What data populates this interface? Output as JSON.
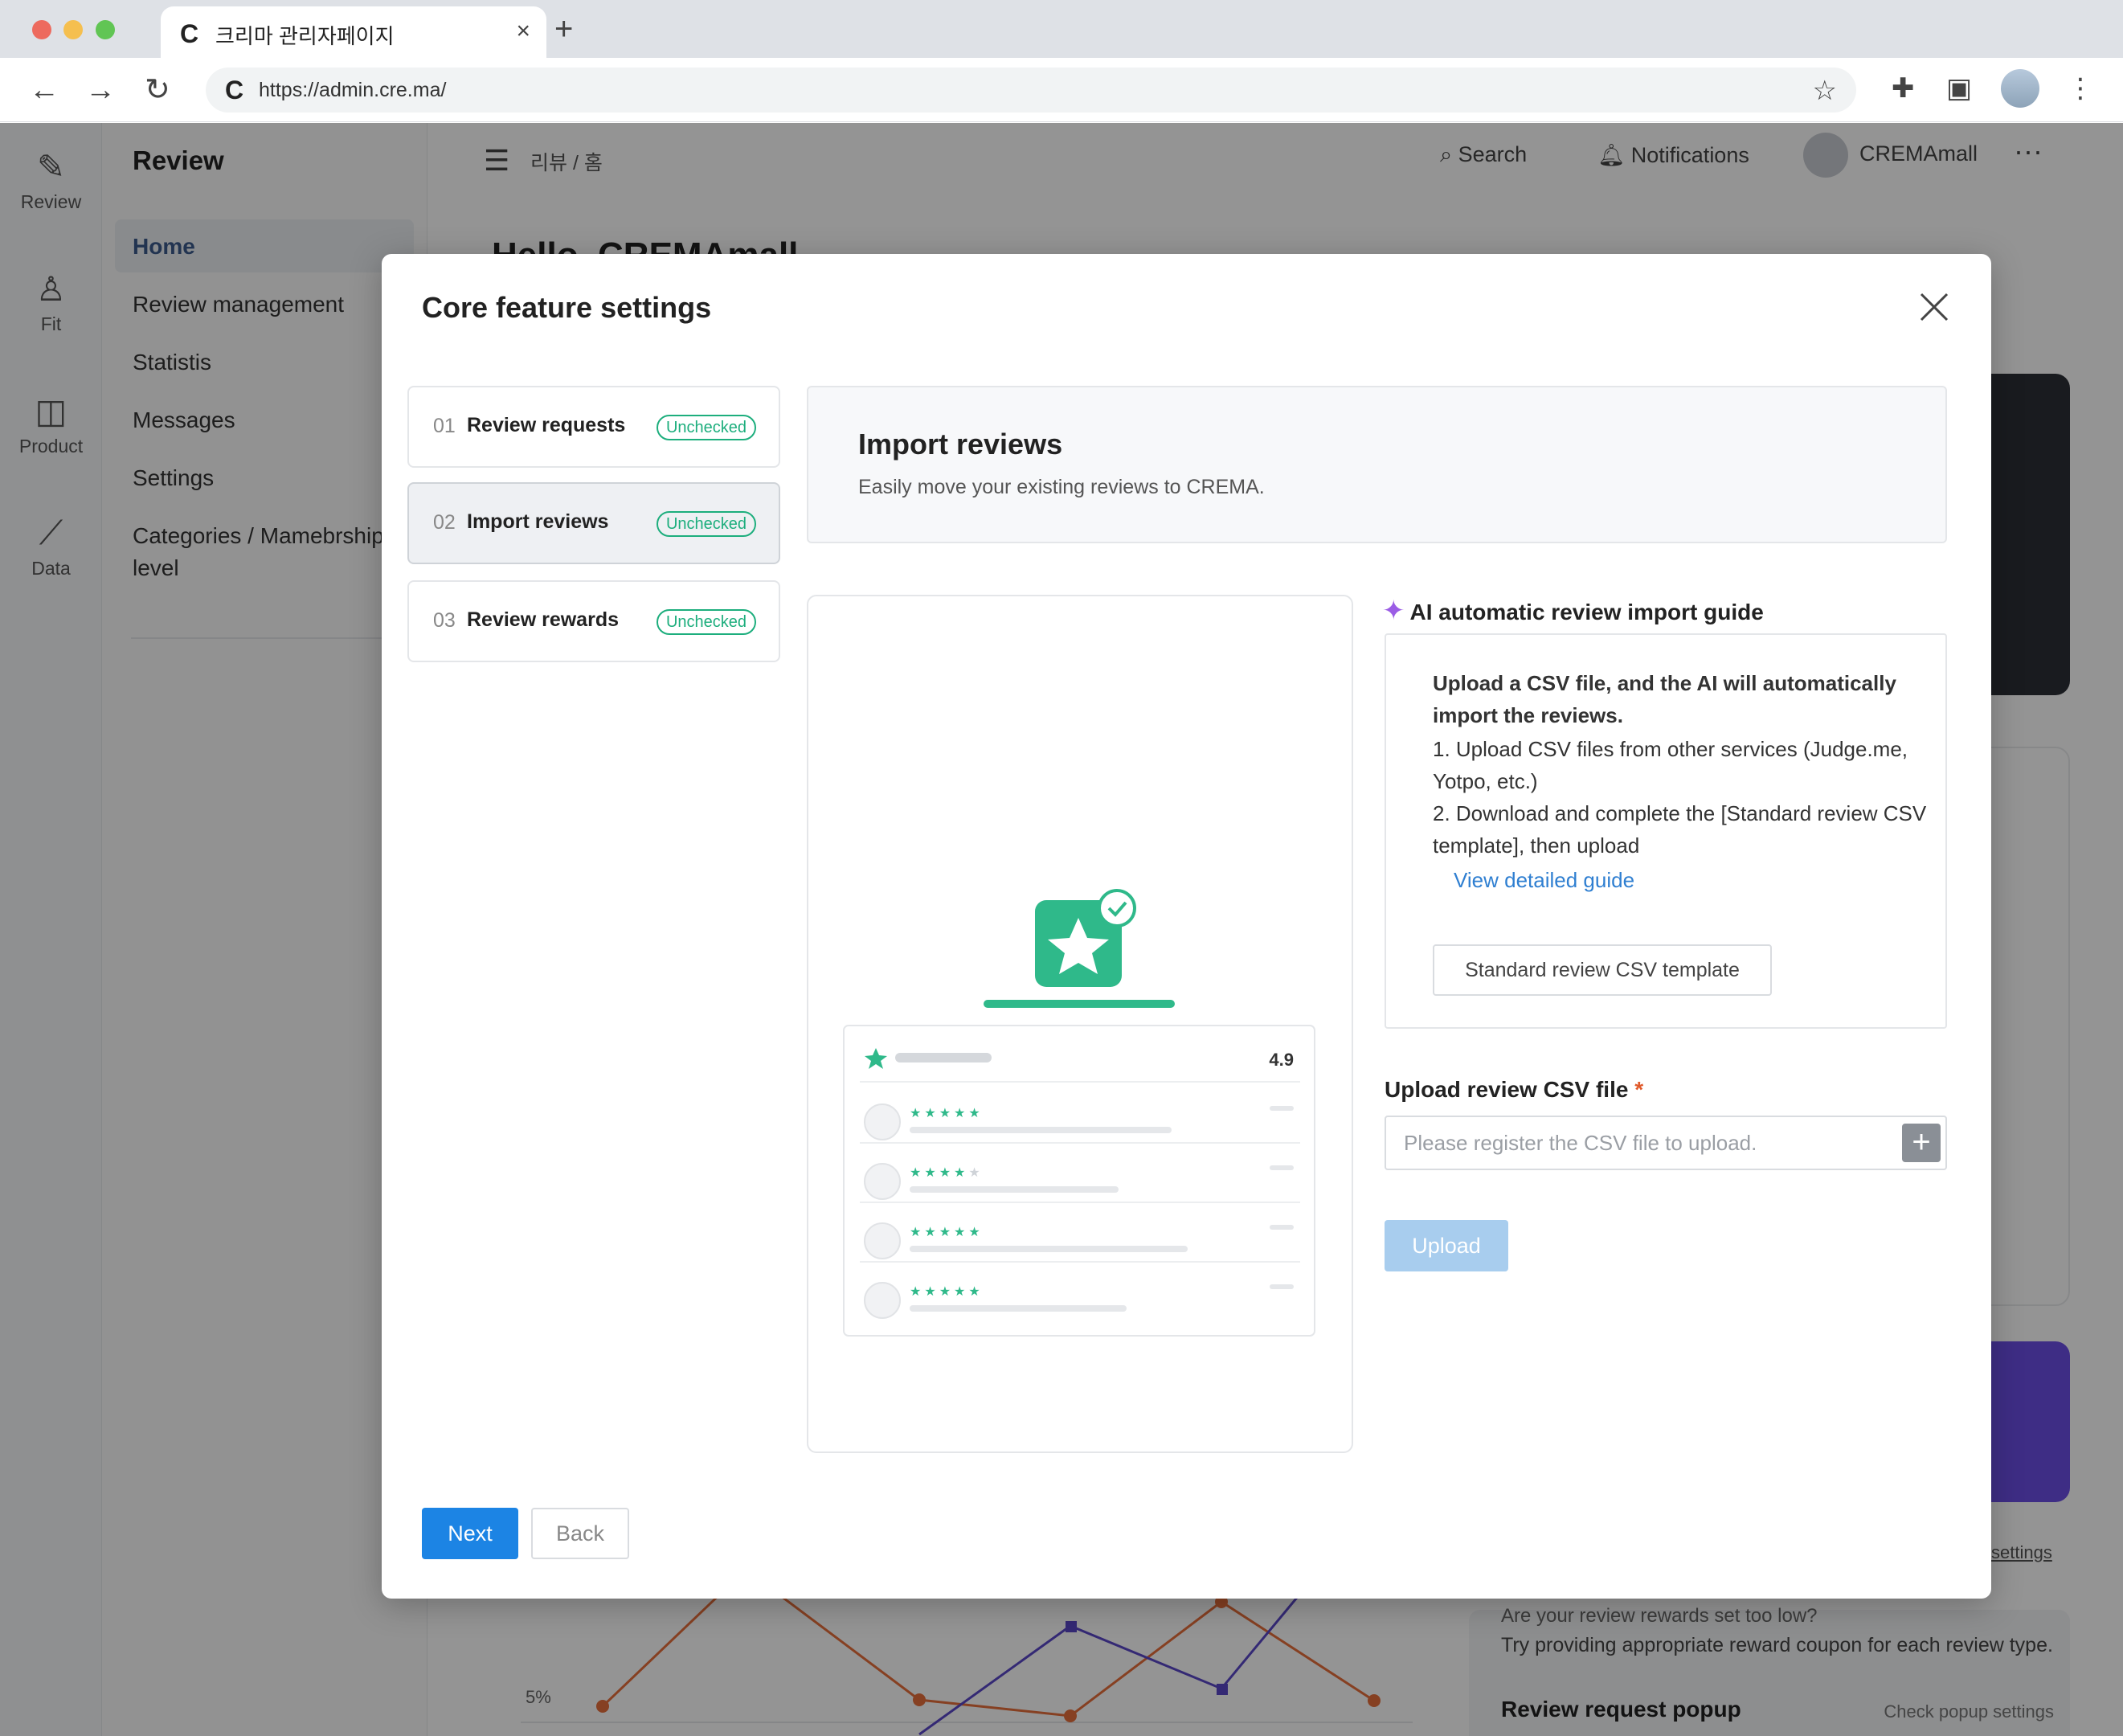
{
  "browser": {
    "tab_title": "크리마 관리자페이지",
    "tab_logo": "C",
    "url": "https://admin.cre.ma/",
    "icons": [
      "back-icon",
      "forward-icon",
      "reload-icon",
      "star-icon",
      "extensions-icon",
      "sidepanel-icon",
      "menu-icon"
    ]
  },
  "rail": {
    "items": [
      {
        "label": "Review",
        "icon": "edit-icon"
      },
      {
        "label": "Fit",
        "icon": "user-check-icon"
      },
      {
        "label": "Product",
        "icon": "bag-icon"
      },
      {
        "label": "Data",
        "icon": "chart-icon"
      }
    ]
  },
  "sidebar": {
    "title": "Review",
    "items": [
      {
        "label": "Home",
        "active": true
      },
      {
        "label": "Review management"
      },
      {
        "label": "Statistis"
      },
      {
        "label": "Messages"
      },
      {
        "label": "Settings"
      },
      {
        "label": "Categories / Mamebrship level"
      }
    ]
  },
  "topbar": {
    "breadcrumb": "리뷰 / 홈",
    "search": "Search",
    "notifications": "Notifications",
    "user": "CREMAmall",
    "hello": "Hello, CREMAmall"
  },
  "background": {
    "settings_link": "settings",
    "reward_line1": "Are your review rewards set too low?",
    "reward_line2": "Try providing appropriate reward coupon for each review type.",
    "popup_title": "Review request popup",
    "popup_link": "Check popup settings",
    "chart_tick": "5%"
  },
  "modal": {
    "title": "Core feature settings",
    "steps": [
      {
        "num": "01",
        "label": "Review requests",
        "badge": "Unchecked"
      },
      {
        "num": "02",
        "label": "Import reviews",
        "badge": "Unchecked",
        "active": true
      },
      {
        "num": "03",
        "label": "Review rewards",
        "badge": "Unchecked"
      }
    ],
    "header": {
      "title": "Import reviews",
      "subtitle": "Easily move your existing reviews to CREMA."
    },
    "illustration": {
      "rating": "4.9"
    },
    "guide": {
      "title": "AI automatic review import guide",
      "lead": "Upload a CSV file, and the AI will automatically import the reviews.",
      "step1": "1. Upload CSV files from other services (Judge.me, Yotpo, etc.)",
      "step2": "2. Download and complete the [Standard review CSV template], then upload",
      "link": "View detailed guide",
      "template_button": "Standard review CSV template"
    },
    "upload": {
      "label": "Upload review CSV file",
      "required_mark": "*",
      "placeholder": "Please register the CSV file to upload.",
      "value": "",
      "button": "Upload"
    },
    "footer": {
      "next": "Next",
      "back": "Back"
    }
  },
  "colors": {
    "primary": "#1c84e4",
    "success": "#1dae7d",
    "upload_disabled": "#a8cdee",
    "link": "#2f7fd1"
  }
}
